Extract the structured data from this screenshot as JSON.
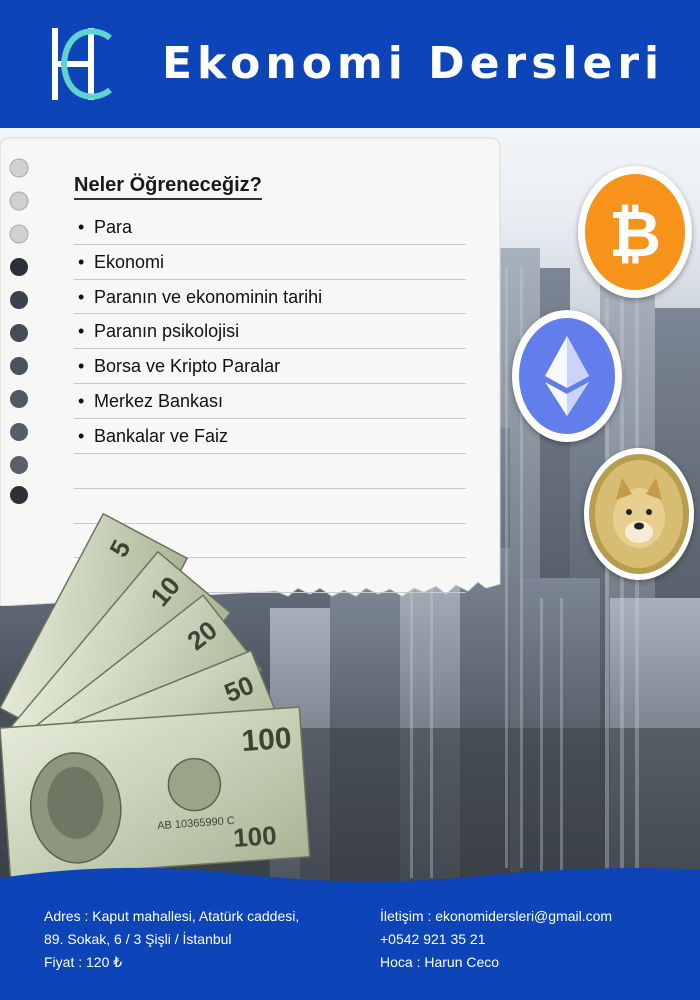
{
  "header": {
    "title": "Ekonomi Dersleri",
    "logo_icon": "hc-monogram-logo-icon",
    "background_color": "#0d44b8",
    "accent_color": "#5fd3d0"
  },
  "note": {
    "heading": "Neler Öğreneceğiz?",
    "items": [
      "Para",
      "Ekonomi",
      "Paranın ve ekonominin tarihi",
      "Paranın psikolojisi",
      "Borsa ve Kripto Paralar",
      "Merkez Bankası",
      "Bankalar ve Faiz"
    ],
    "bullet": "•"
  },
  "coins": {
    "bitcoin": {
      "icon": "bitcoin-icon",
      "color": "#f7931a",
      "symbol": "₿"
    },
    "ethereum": {
      "icon": "ethereum-icon",
      "color": "#627eea"
    },
    "dogecoin": {
      "icon": "dogecoin-icon",
      "color": "#c2a633"
    }
  },
  "money_image": {
    "icon": "dollar-bills-icon",
    "labels": [
      "5",
      "10",
      "20",
      "50",
      "100"
    ],
    "serial": "AB 10365990 C"
  },
  "footer": {
    "address_line1": "Adres : Kaput mahallesi, Atatürk caddesi,",
    "address_line2": "89. Sokak, 6 / 3 Şişli / İstanbul",
    "price": "Fiyat : 120 ₺",
    "contact_email": "İletişim : ekonomidersleri@gmail.com",
    "phone": "+0542 921 35 21",
    "teacher": "Hoca : Harun Ceco"
  }
}
